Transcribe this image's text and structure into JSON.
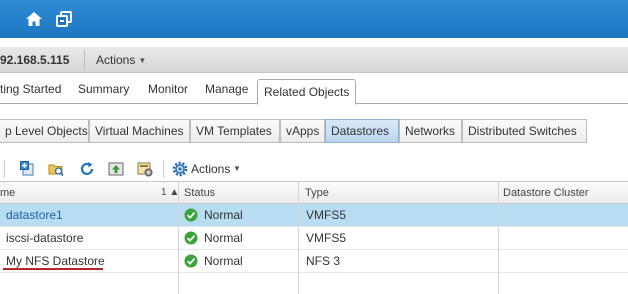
{
  "colors": {
    "topbar": "#1d76c2",
    "selected_row": "#b8dcf2",
    "status_ok": "#3aa33a",
    "annotation": "#b3272d"
  },
  "icons": {
    "home": "home-icon",
    "navigator": "navigator-icon"
  },
  "header": {
    "host": "92.168.5.115",
    "actions_label": "Actions"
  },
  "tabs": [
    "ting Started",
    "Summary",
    "Monitor",
    "Manage",
    "Related Objects"
  ],
  "subtabs": [
    "p Level Objects",
    "Virtual Machines",
    "VM Templates",
    "vApps",
    "Datastores",
    "Networks",
    "Distributed Switches"
  ],
  "toolbar": {
    "actions_label": "Actions"
  },
  "grid": {
    "columns": [
      "me",
      "Status",
      "Type",
      "Datastore Cluster"
    ],
    "sort_indicator": "1 ▲",
    "rows": [
      {
        "name": "datastore1",
        "status": "Normal",
        "type": "VMFS5",
        "cluster": ""
      },
      {
        "name": "iscsi-datastore",
        "status": "Normal",
        "type": "VMFS5",
        "cluster": ""
      },
      {
        "name": "My NFS Datastore",
        "status": "Normal",
        "type": "NFS 3",
        "cluster": ""
      }
    ]
  }
}
